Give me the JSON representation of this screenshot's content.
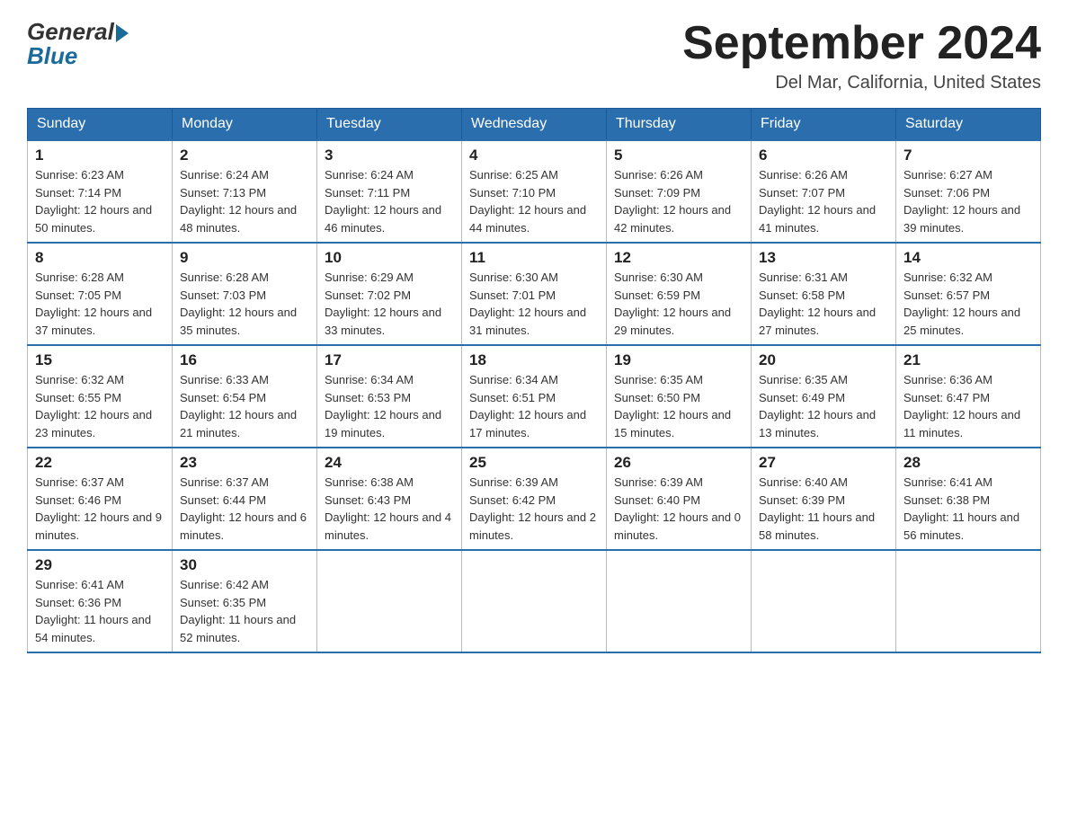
{
  "header": {
    "logo_general": "General",
    "logo_blue": "Blue",
    "month_title": "September 2024",
    "location": "Del Mar, California, United States"
  },
  "days_of_week": [
    "Sunday",
    "Monday",
    "Tuesday",
    "Wednesday",
    "Thursday",
    "Friday",
    "Saturday"
  ],
  "weeks": [
    [
      {
        "day": "1",
        "sunrise": "6:23 AM",
        "sunset": "7:14 PM",
        "daylight": "12 hours and 50 minutes."
      },
      {
        "day": "2",
        "sunrise": "6:24 AM",
        "sunset": "7:13 PM",
        "daylight": "12 hours and 48 minutes."
      },
      {
        "day": "3",
        "sunrise": "6:24 AM",
        "sunset": "7:11 PM",
        "daylight": "12 hours and 46 minutes."
      },
      {
        "day": "4",
        "sunrise": "6:25 AM",
        "sunset": "7:10 PM",
        "daylight": "12 hours and 44 minutes."
      },
      {
        "day": "5",
        "sunrise": "6:26 AM",
        "sunset": "7:09 PM",
        "daylight": "12 hours and 42 minutes."
      },
      {
        "day": "6",
        "sunrise": "6:26 AM",
        "sunset": "7:07 PM",
        "daylight": "12 hours and 41 minutes."
      },
      {
        "day": "7",
        "sunrise": "6:27 AM",
        "sunset": "7:06 PM",
        "daylight": "12 hours and 39 minutes."
      }
    ],
    [
      {
        "day": "8",
        "sunrise": "6:28 AM",
        "sunset": "7:05 PM",
        "daylight": "12 hours and 37 minutes."
      },
      {
        "day": "9",
        "sunrise": "6:28 AM",
        "sunset": "7:03 PM",
        "daylight": "12 hours and 35 minutes."
      },
      {
        "day": "10",
        "sunrise": "6:29 AM",
        "sunset": "7:02 PM",
        "daylight": "12 hours and 33 minutes."
      },
      {
        "day": "11",
        "sunrise": "6:30 AM",
        "sunset": "7:01 PM",
        "daylight": "12 hours and 31 minutes."
      },
      {
        "day": "12",
        "sunrise": "6:30 AM",
        "sunset": "6:59 PM",
        "daylight": "12 hours and 29 minutes."
      },
      {
        "day": "13",
        "sunrise": "6:31 AM",
        "sunset": "6:58 PM",
        "daylight": "12 hours and 27 minutes."
      },
      {
        "day": "14",
        "sunrise": "6:32 AM",
        "sunset": "6:57 PM",
        "daylight": "12 hours and 25 minutes."
      }
    ],
    [
      {
        "day": "15",
        "sunrise": "6:32 AM",
        "sunset": "6:55 PM",
        "daylight": "12 hours and 23 minutes."
      },
      {
        "day": "16",
        "sunrise": "6:33 AM",
        "sunset": "6:54 PM",
        "daylight": "12 hours and 21 minutes."
      },
      {
        "day": "17",
        "sunrise": "6:34 AM",
        "sunset": "6:53 PM",
        "daylight": "12 hours and 19 minutes."
      },
      {
        "day": "18",
        "sunrise": "6:34 AM",
        "sunset": "6:51 PM",
        "daylight": "12 hours and 17 minutes."
      },
      {
        "day": "19",
        "sunrise": "6:35 AM",
        "sunset": "6:50 PM",
        "daylight": "12 hours and 15 minutes."
      },
      {
        "day": "20",
        "sunrise": "6:35 AM",
        "sunset": "6:49 PM",
        "daylight": "12 hours and 13 minutes."
      },
      {
        "day": "21",
        "sunrise": "6:36 AM",
        "sunset": "6:47 PM",
        "daylight": "12 hours and 11 minutes."
      }
    ],
    [
      {
        "day": "22",
        "sunrise": "6:37 AM",
        "sunset": "6:46 PM",
        "daylight": "12 hours and 9 minutes."
      },
      {
        "day": "23",
        "sunrise": "6:37 AM",
        "sunset": "6:44 PM",
        "daylight": "12 hours and 6 minutes."
      },
      {
        "day": "24",
        "sunrise": "6:38 AM",
        "sunset": "6:43 PM",
        "daylight": "12 hours and 4 minutes."
      },
      {
        "day": "25",
        "sunrise": "6:39 AM",
        "sunset": "6:42 PM",
        "daylight": "12 hours and 2 minutes."
      },
      {
        "day": "26",
        "sunrise": "6:39 AM",
        "sunset": "6:40 PM",
        "daylight": "12 hours and 0 minutes."
      },
      {
        "day": "27",
        "sunrise": "6:40 AM",
        "sunset": "6:39 PM",
        "daylight": "11 hours and 58 minutes."
      },
      {
        "day": "28",
        "sunrise": "6:41 AM",
        "sunset": "6:38 PM",
        "daylight": "11 hours and 56 minutes."
      }
    ],
    [
      {
        "day": "29",
        "sunrise": "6:41 AM",
        "sunset": "6:36 PM",
        "daylight": "11 hours and 54 minutes."
      },
      {
        "day": "30",
        "sunrise": "6:42 AM",
        "sunset": "6:35 PM",
        "daylight": "11 hours and 52 minutes."
      },
      null,
      null,
      null,
      null,
      null
    ]
  ],
  "labels": {
    "sunrise_prefix": "Sunrise: ",
    "sunset_prefix": "Sunset: ",
    "daylight_prefix": "Daylight: "
  }
}
